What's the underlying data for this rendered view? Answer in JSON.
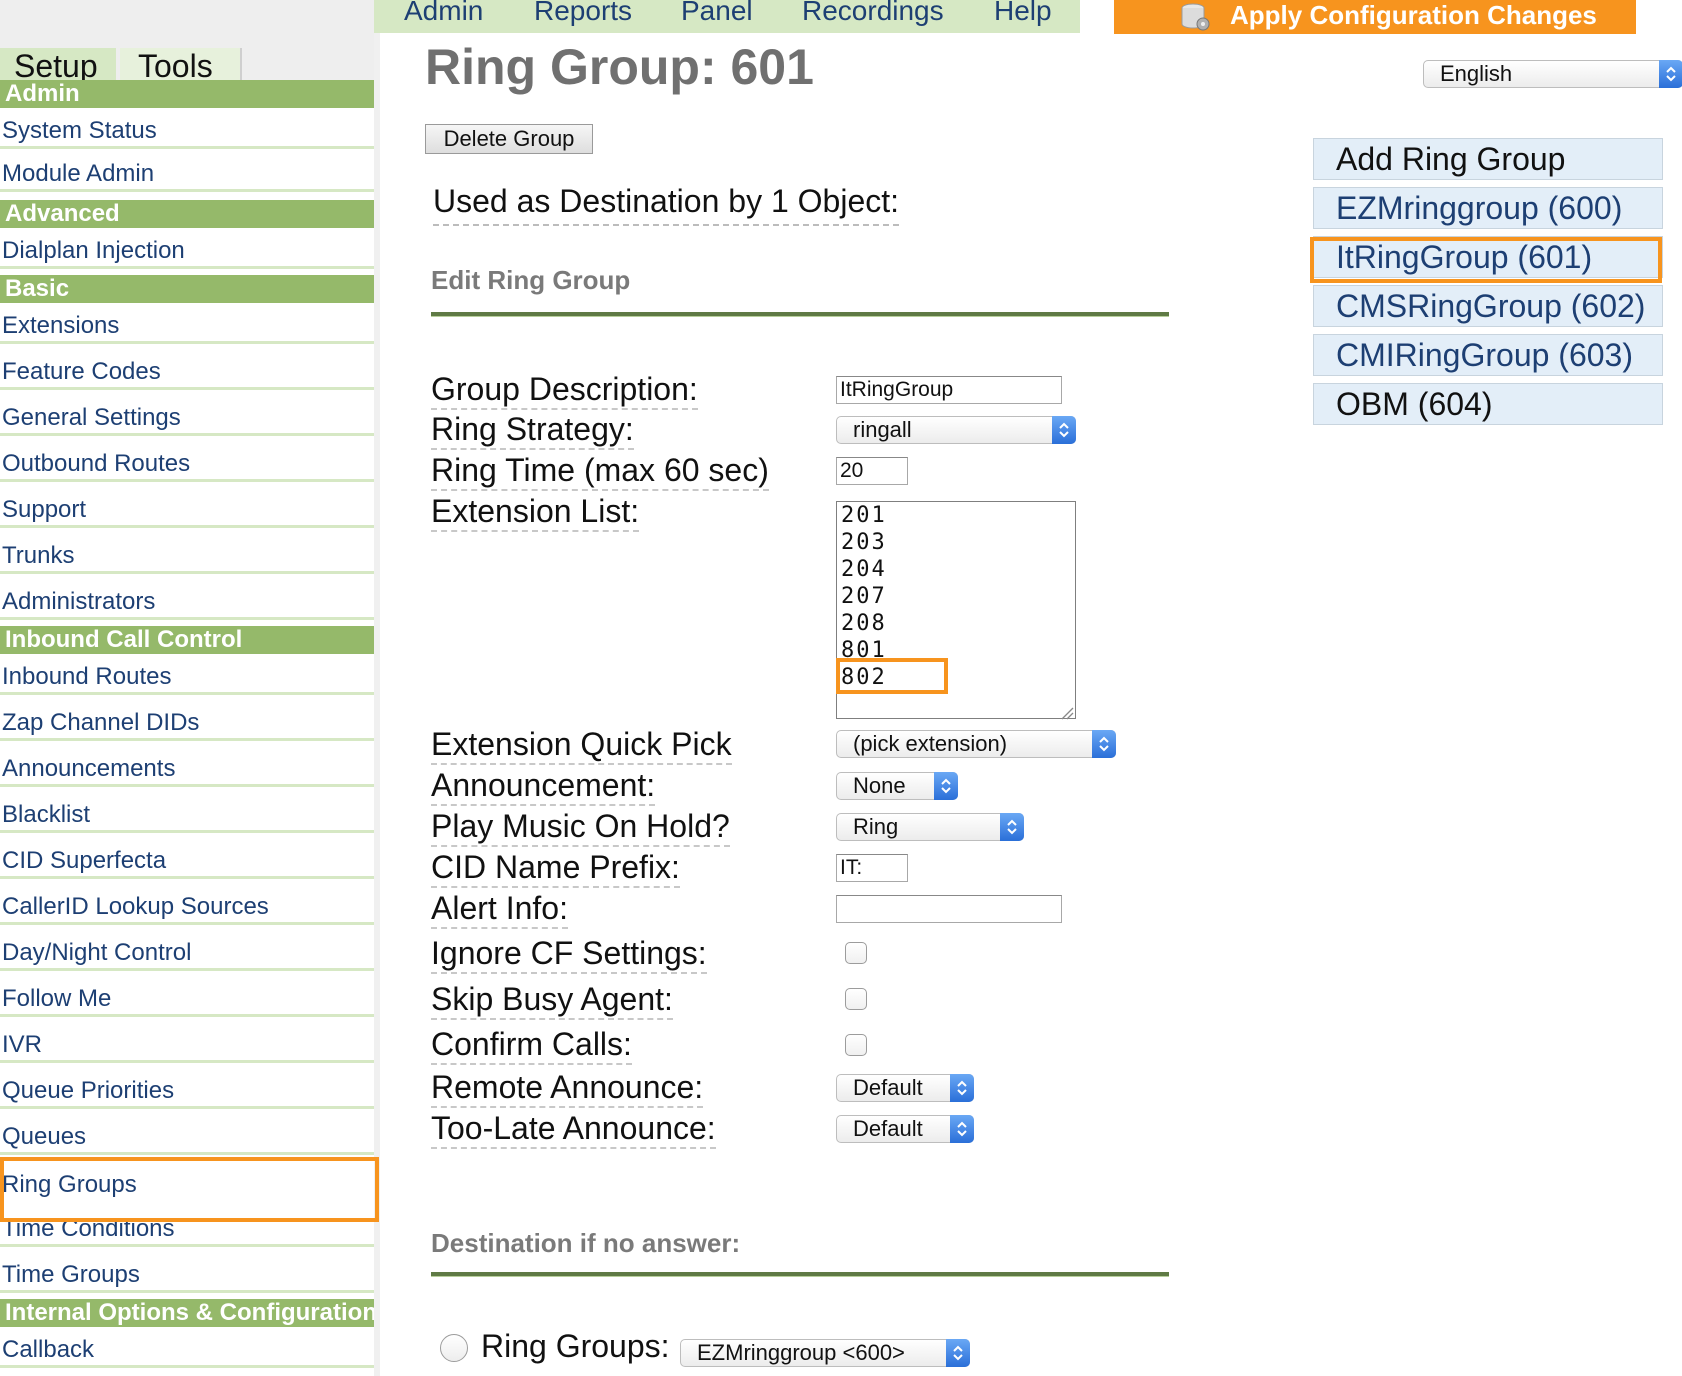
{
  "topnav": {
    "items": [
      {
        "label": "Admin"
      },
      {
        "label": "Reports"
      },
      {
        "label": "Panel"
      },
      {
        "label": "Recordings"
      },
      {
        "label": "Help"
      }
    ],
    "apply_label": "Apply Configuration Changes"
  },
  "sidebar": {
    "tabs": {
      "setup": "Setup",
      "tools": "Tools"
    },
    "sections": [
      {
        "header": "Admin",
        "items": [
          "System Status",
          "Module Admin"
        ]
      },
      {
        "header": "Advanced",
        "items": [
          "Dialplan Injection"
        ]
      },
      {
        "header": "Basic",
        "items": [
          "Extensions",
          "Feature Codes",
          "General Settings",
          "Outbound Routes",
          "Support",
          "Trunks",
          "Administrators"
        ]
      },
      {
        "header": "Inbound Call Control",
        "items": [
          "Inbound Routes",
          "Zap Channel DIDs",
          "Announcements",
          "Blacklist",
          "CID Superfecta",
          "CallerID Lookup Sources",
          "Day/Night Control",
          "Follow Me",
          "IVR",
          "Queue Priorities",
          "Queues",
          "Ring Groups",
          "Time Conditions",
          "Time Groups"
        ]
      },
      {
        "header": "Internal Options & Configuration",
        "items": [
          "Callback"
        ]
      }
    ]
  },
  "main": {
    "title": "Ring Group: 601",
    "delete_label": "Delete Group",
    "used_as": "Used as Destination by 1 Object:",
    "edit_section": "Edit Ring Group",
    "fields": {
      "group_description": {
        "label": "Group Description:",
        "value": "ItRingGroup"
      },
      "ring_strategy": {
        "label": "Ring Strategy:",
        "value": "ringall"
      },
      "ring_time": {
        "label": "Ring Time (max 60 sec)",
        "value": "20"
      },
      "extension_list": {
        "label": "Extension List:",
        "values": [
          "201",
          "203",
          "204",
          "207",
          "208",
          "801",
          "802"
        ]
      },
      "quick_pick": {
        "label": "Extension Quick Pick",
        "value": "(pick extension)"
      },
      "announcement": {
        "label": "Announcement:",
        "value": "None"
      },
      "music_on_hold": {
        "label": "Play Music On Hold?",
        "value": "Ring"
      },
      "cid_prefix": {
        "label": "CID Name Prefix:",
        "value": "IT:"
      },
      "alert_info": {
        "label": "Alert Info:",
        "value": ""
      },
      "ignore_cf": {
        "label": "Ignore CF Settings:",
        "checked": false
      },
      "skip_busy": {
        "label": "Skip Busy Agent:",
        "checked": false
      },
      "confirm_calls": {
        "label": "Confirm Calls:",
        "checked": false
      },
      "remote_announce": {
        "label": "Remote Announce:",
        "value": "Default"
      },
      "too_late_announce": {
        "label": "Too-Late Announce:",
        "value": "Default"
      }
    },
    "destination_section": "Destination if no answer:",
    "destination": {
      "label": "Ring Groups:",
      "value": "EZMringgroup <600>"
    }
  },
  "right": {
    "language": "English",
    "ring_groups": [
      {
        "label": "Add Ring Group"
      },
      {
        "label": "EZMringgroup (600)"
      },
      {
        "label": "ItRingGroup (601)"
      },
      {
        "label": "CMSRingGroup (602)"
      },
      {
        "label": "CMIRingGroup (603)"
      },
      {
        "label": "OBM (604)"
      }
    ]
  },
  "colors": {
    "accent_orange": "#f7941e",
    "sidebar_header": "#95b96a",
    "nav_bg": "#d6e8c4",
    "link_blue": "#1d3f73"
  }
}
